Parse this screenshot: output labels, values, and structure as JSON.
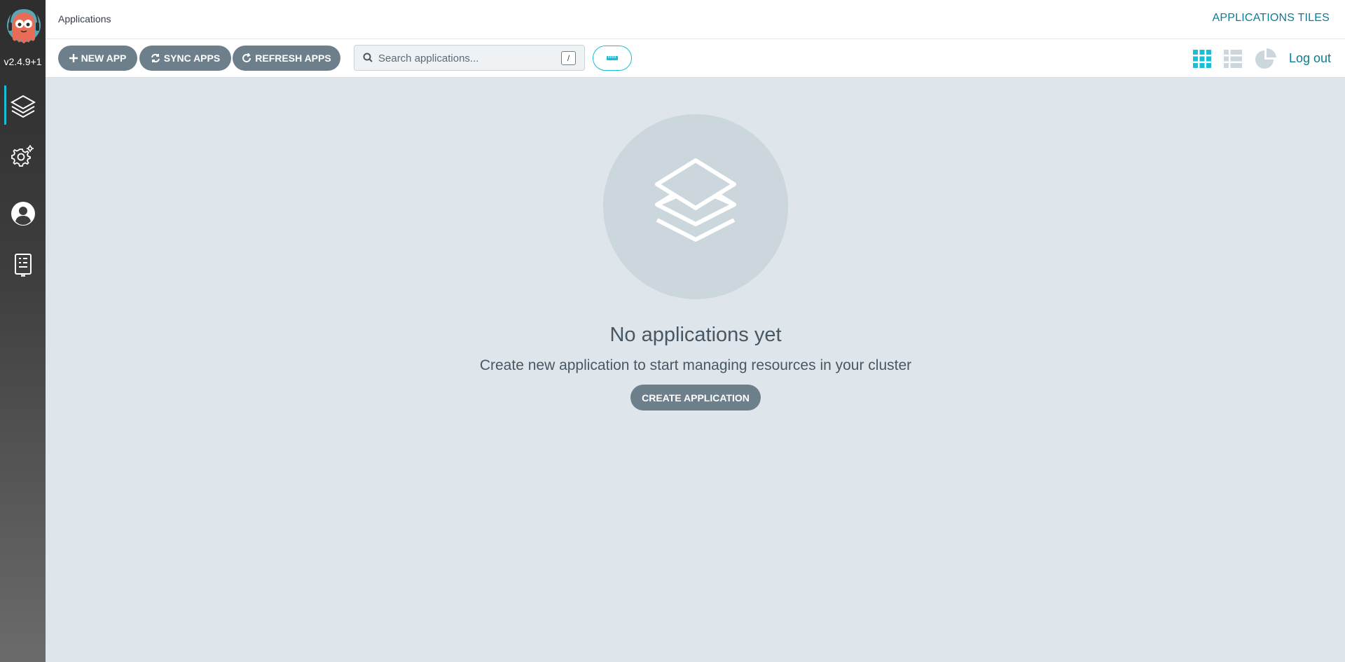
{
  "sidebar": {
    "version": "v2.4.9+1",
    "items": [
      {
        "name": "applications",
        "icon": "layers-icon",
        "active": true
      },
      {
        "name": "settings",
        "icon": "gear-icon"
      },
      {
        "name": "user-info",
        "icon": "user-icon"
      },
      {
        "name": "documentation",
        "icon": "help-book-icon"
      }
    ]
  },
  "header": {
    "breadcrumb": "Applications",
    "page_mode": "APPLICATIONS TILES"
  },
  "toolbar": {
    "new_app_label": "NEW APP",
    "sync_apps_label": "SYNC APPS",
    "refresh_apps_label": "REFRESH APPS",
    "search_placeholder": "Search applications...",
    "search_value": "",
    "search_shortcut": "/",
    "views": [
      "tiles-view-icon",
      "list-view-icon",
      "summary-pie-icon"
    ],
    "active_view": "tiles-view-icon",
    "logout_label": "Log out"
  },
  "empty_state": {
    "title": "No applications yet",
    "description": "Create new application to start managing resources in your cluster",
    "create_label": "CREATE APPLICATION"
  },
  "colors": {
    "accent": "#18bed6",
    "link": "#0b7c94",
    "button": "#6d7f8b",
    "background": "#dee6eb"
  }
}
